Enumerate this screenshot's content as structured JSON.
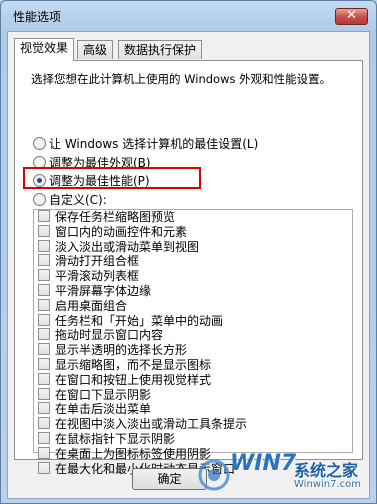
{
  "window": {
    "title": "性能选项",
    "close_label": "✕"
  },
  "tabs": [
    {
      "label": "视觉效果",
      "active": true
    },
    {
      "label": "高级",
      "active": false
    },
    {
      "label": "数据执行保护",
      "active": false
    }
  ],
  "description": "选择您想在此计算机上使用的 Windows 外观和性能设置。",
  "radio_options": [
    {
      "label": "让 Windows 选择计算机的最佳设置(L)",
      "checked": false
    },
    {
      "label": "调整为最佳外观(B)",
      "checked": false
    },
    {
      "label": "调整为最佳性能(P)",
      "checked": true
    },
    {
      "label": "自定义(C):",
      "checked": false
    }
  ],
  "effects": [
    "保存任务栏缩略图预览",
    "窗口内的动画控件和元素",
    "淡入淡出或滑动菜单到视图",
    "滑动打开组合框",
    "平滑滚动列表框",
    "平滑屏幕字体边缘",
    "启用桌面组合",
    "任务栏和「开始」菜单中的动画",
    "拖动时显示窗口内容",
    "显示半透明的选择长方形",
    "显示缩略图，而不是显示图标",
    "在窗口和按钮上使用视觉样式",
    "在窗口下显示阴影",
    "在单击后淡出菜单",
    "在视图中淡入淡出或滑动工具条提示",
    "在鼠标指针下显示阴影",
    "在桌面上为图标标签使用阴影",
    "在最大化和最小化时动态显示窗口"
  ],
  "ok_button": "确定",
  "watermark": {
    "logo": "WIN7",
    "text": "系统之家",
    "url": "Winwin7.com"
  },
  "colors": {
    "highlight": "#e00000",
    "title_bg": "#b9d1ea"
  }
}
